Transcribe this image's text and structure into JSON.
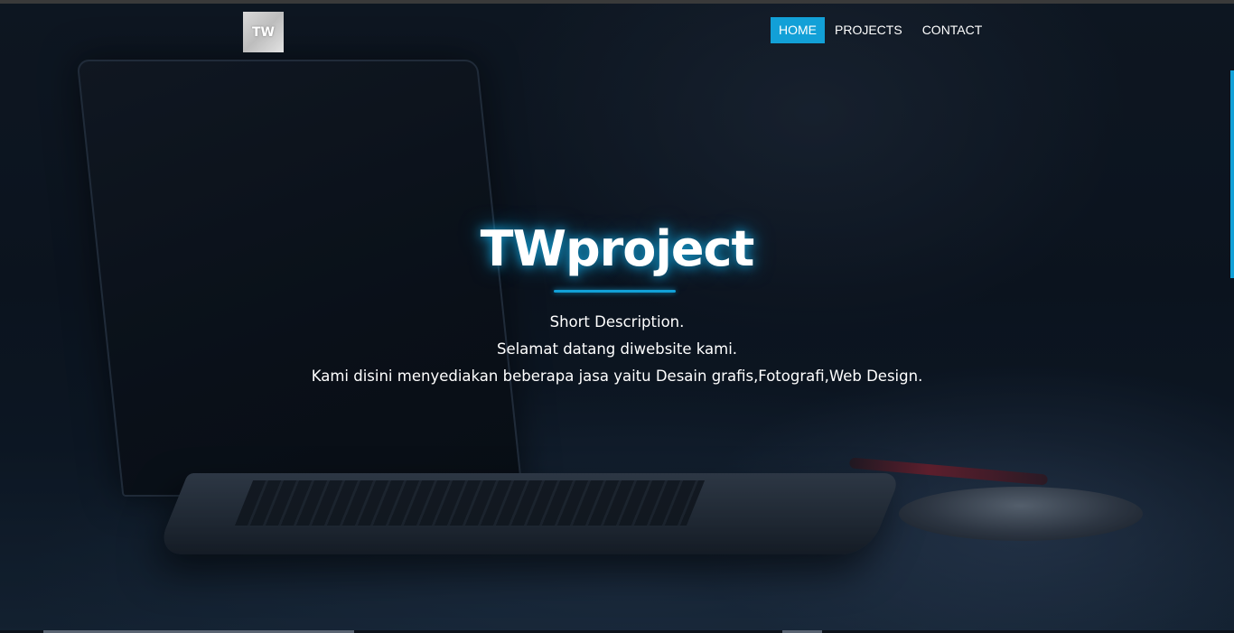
{
  "navbar": {
    "logo_text": "TW",
    "links": [
      {
        "label": "HOME",
        "active": true
      },
      {
        "label": "PROJECTS",
        "active": false
      },
      {
        "label": "CONTACT",
        "active": false
      }
    ]
  },
  "hero": {
    "title": "TWproject",
    "lines": [
      "Short Description.",
      "Selamat datang diwebsite kami.",
      "Kami disini menyediakan beberapa jasa yaitu Desain grafis,Fotografi,Web Design."
    ]
  },
  "colors": {
    "accent": "#12a0d7",
    "text": "#ffffff",
    "background": "#0e1622"
  }
}
